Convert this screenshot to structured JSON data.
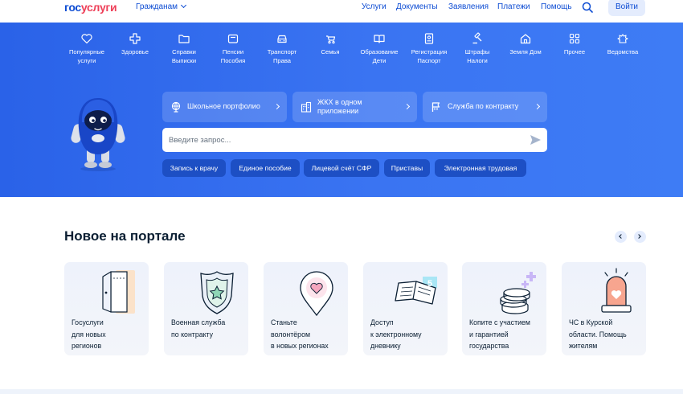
{
  "header": {
    "logo_part1": "гос",
    "logo_part2": "услуги",
    "audience": "Гражданам",
    "nav": [
      "Услуги",
      "Документы",
      "Заявления",
      "Платежи",
      "Помощь"
    ],
    "login": "Войти"
  },
  "categories": [
    {
      "label": "Популярные\nуслуги",
      "icon": "heart-icon"
    },
    {
      "label": "Здоровье",
      "icon": "cross-icon"
    },
    {
      "label": "Справки\nВыписки",
      "icon": "folder-icon"
    },
    {
      "label": "Пенсии\nПособия",
      "icon": "wallet-icon"
    },
    {
      "label": "Транспорт\nПрава",
      "icon": "car-icon"
    },
    {
      "label": "Семья",
      "icon": "stroller-icon"
    },
    {
      "label": "Образование\nДети",
      "icon": "book-icon"
    },
    {
      "label": "Регистрация\nПаспорт",
      "icon": "passport-icon"
    },
    {
      "label": "Штрафы\nНалоги",
      "icon": "gavel-icon"
    },
    {
      "label": "Земля Дом",
      "icon": "house-icon"
    },
    {
      "label": "Прочее",
      "icon": "grid-icon"
    },
    {
      "label": "Ведомства",
      "icon": "emblem-icon"
    }
  ],
  "quick_links": [
    {
      "label": "Школьное портфолио",
      "icon": "globe-icon"
    },
    {
      "label": "ЖКХ в одном\nприложении",
      "icon": "building-icon"
    },
    {
      "label": "Служба по контракту",
      "icon": "flag-icon"
    }
  ],
  "search": {
    "placeholder": "Введите запрос..."
  },
  "chips": [
    "Запись к врачу",
    "Единое пособие",
    "Лицевой счёт СФР",
    "Приставы",
    "Электронная трудовая"
  ],
  "news": {
    "title": "Новое на портале",
    "cards": [
      {
        "label": "Госуслуги\nдля новых\nрегионов",
        "icon": "door-icon"
      },
      {
        "label": "Военная служба\nпо контракту",
        "icon": "shield-star-icon"
      },
      {
        "label": "Станьте\nволонтёром\nв новых регионах",
        "icon": "map-pin-heart-icon"
      },
      {
        "label": "Доступ\nк электронному\nдневнику",
        "icon": "diary-icon"
      },
      {
        "label": "Копите с участием\nи гарантией\nгосударства",
        "icon": "coins-icon"
      },
      {
        "label": "ЧС в Курской\nобласти. Помощь\nжителям",
        "icon": "alarm-light-icon"
      }
    ]
  },
  "colors": {
    "brand_blue": "#0d4cd3",
    "brand_red": "#ee3f58",
    "hero_blue": "#3a74f2",
    "chip_blue": "#1d4fc4"
  }
}
